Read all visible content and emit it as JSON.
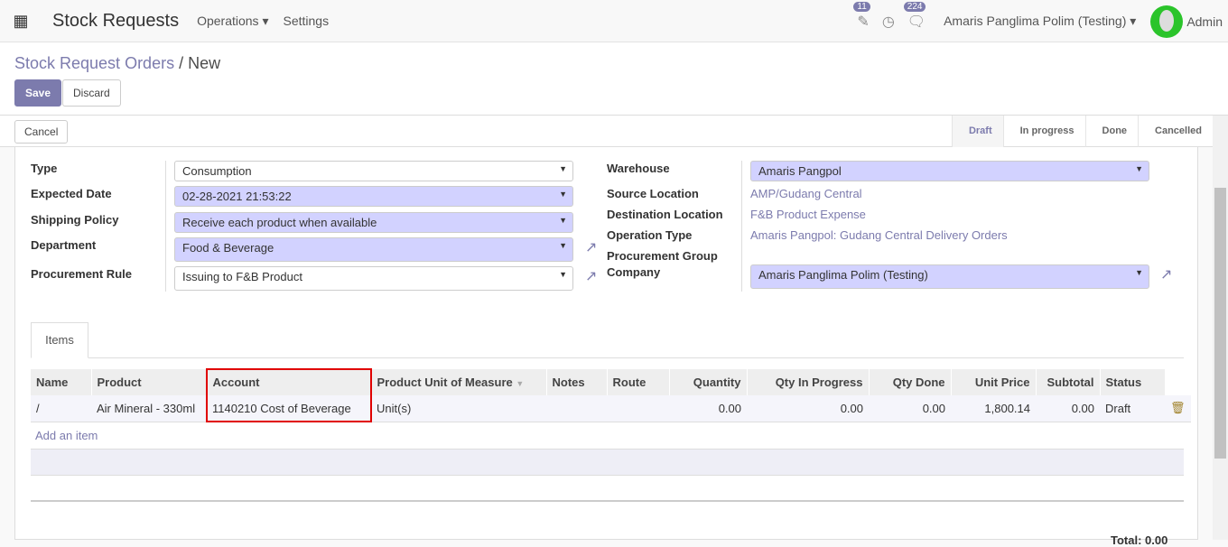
{
  "nav": {
    "app_title": "Stock Requests",
    "menus": [
      "Operations",
      "Settings"
    ],
    "activity_count": "11",
    "message_count": "224",
    "company": "Amaris Panglima Polim (Testing)",
    "user": "Admin"
  },
  "breadcrumb": {
    "parent": "Stock Request Orders",
    "current": "New"
  },
  "buttons": {
    "save": "Save",
    "discard": "Discard",
    "cancel": "Cancel"
  },
  "stages": [
    "Draft",
    "In progress",
    "Done",
    "Cancelled"
  ],
  "active_stage": "Draft",
  "form": {
    "type": {
      "label": "Type",
      "value": "Consumption"
    },
    "expected_date": {
      "label": "Expected Date",
      "value": "02-28-2021 21:53:22"
    },
    "shipping_policy": {
      "label": "Shipping Policy",
      "value": "Receive each product when available"
    },
    "department": {
      "label": "Department",
      "value": "Food & Beverage"
    },
    "procurement_rule": {
      "label": "Procurement Rule",
      "value": "Issuing to F&B Product"
    },
    "warehouse": {
      "label": "Warehouse",
      "value": "Amaris Pangpol"
    },
    "source_location": {
      "label": "Source Location",
      "value": "AMP/Gudang Central"
    },
    "destination_location": {
      "label": "Destination Location",
      "value": "F&B Product Expense"
    },
    "operation_type": {
      "label": "Operation Type",
      "value": "Amaris Pangpol: Gudang Central Delivery Orders"
    },
    "procurement_group": {
      "label": "Procurement Group"
    },
    "company": {
      "label": "Company",
      "value": "Amaris Panglima Polim (Testing)"
    }
  },
  "tab": "Items",
  "table": {
    "columns": [
      "Name",
      "Product",
      "Account",
      "Product Unit of Measure",
      "Notes",
      "Route",
      "Quantity",
      "Qty In Progress",
      "Qty Done",
      "Unit Price",
      "Subtotal",
      "Status"
    ],
    "rows": [
      [
        "/",
        "Air Mineral - 330ml",
        "1140210 Cost of Beverage",
        "Unit(s)",
        "",
        "",
        "0.00",
        "0.00",
        "0.00",
        "1,800.14",
        "0.00",
        "Draft"
      ]
    ],
    "add_item": "Add an item"
  },
  "total": {
    "label": "Total:",
    "value": "0.00"
  },
  "highlight_color": "#e00000"
}
